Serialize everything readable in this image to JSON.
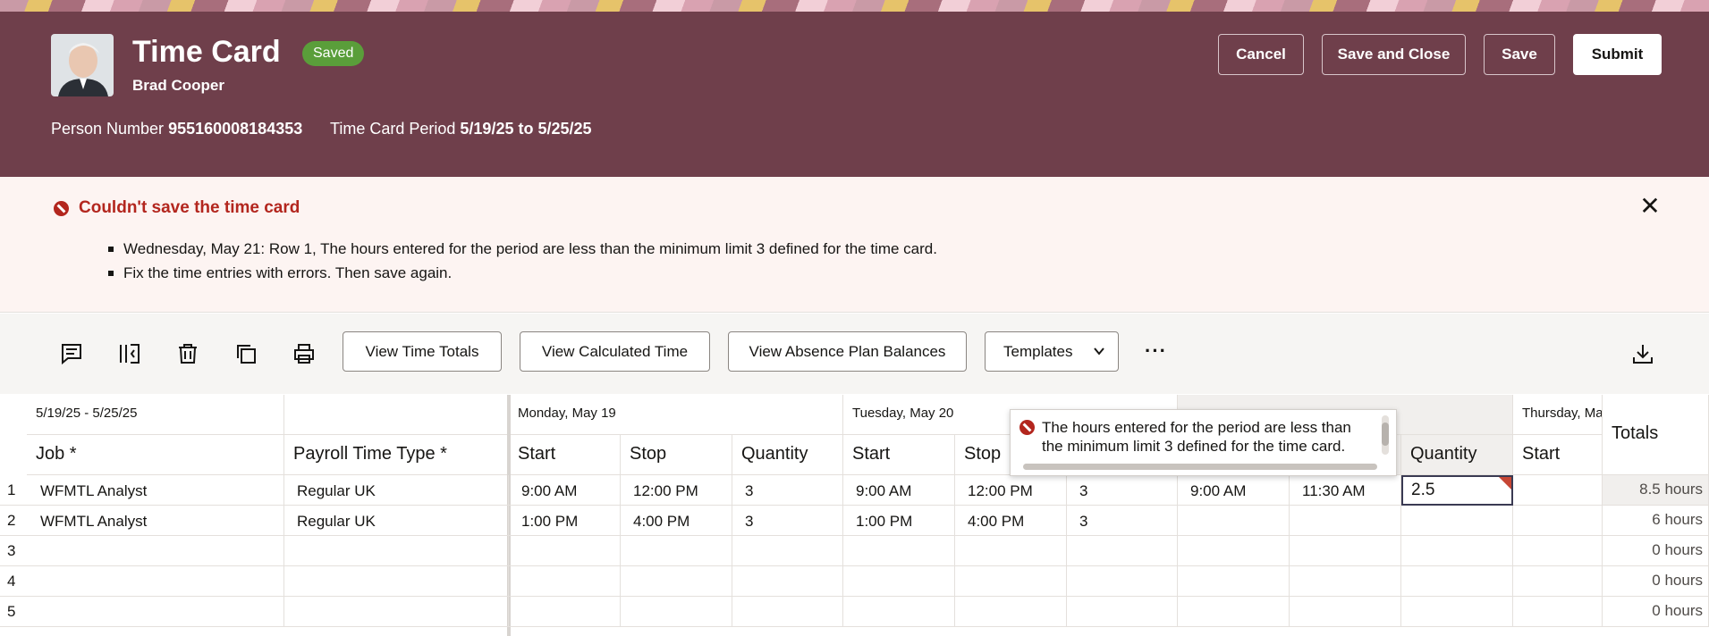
{
  "header": {
    "title": "Time Card",
    "status_badge": "Saved",
    "person_name": "Brad Cooper",
    "person_number_label": "Person Number",
    "person_number": "955160008184353",
    "period_label": "Time Card Period",
    "period": "5/19/25 to 5/25/25",
    "buttons": {
      "cancel": "Cancel",
      "save_close": "Save and Close",
      "save": "Save",
      "submit": "Submit"
    }
  },
  "error": {
    "title": "Couldn't save the time card",
    "messages": [
      "Wednesday, May 21: Row 1, The hours entered for the period are less than the minimum limit 3 defined for the time card.",
      "Fix the time entries with errors. Then save again."
    ]
  },
  "toolbar": {
    "icons": [
      "comment-icon",
      "columns-icon",
      "delete-icon",
      "duplicate-icon",
      "print-icon"
    ],
    "buttons": {
      "view_totals": "View Time Totals",
      "view_calculated": "View Calculated Time",
      "view_absence": "View Absence Plan Balances",
      "templates": "Templates"
    },
    "more": "···"
  },
  "grid": {
    "date_range": "5/19/25 - 5/25/25",
    "days": [
      "Monday, May 19",
      "Tuesday, May 20",
      "Thursday, Ma"
    ],
    "columns": {
      "job": "Job *",
      "payroll": "Payroll Time Type *",
      "start": "Start",
      "stop": "Stop",
      "quantity": "Quantity",
      "totals": "Totals"
    },
    "rows": [
      {
        "num": "1",
        "job": "WFMTL Analyst",
        "payroll": "Regular UK",
        "mon_start": "9:00 AM",
        "mon_stop": "12:00 PM",
        "mon_qty": "3",
        "tue_start": "9:00 AM",
        "tue_stop": "12:00 PM",
        "tue_qty": "3",
        "wed_start": "9:00 AM",
        "wed_stop": "11:30 AM",
        "wed_qty": "2.5",
        "total": "8.5 hours"
      },
      {
        "num": "2",
        "job": "WFMTL Analyst",
        "payroll": "Regular UK",
        "mon_start": "1:00 PM",
        "mon_stop": "4:00 PM",
        "mon_qty": "3",
        "tue_start": "1:00 PM",
        "tue_stop": "4:00 PM",
        "tue_qty": "3",
        "wed_start": "",
        "wed_stop": "",
        "wed_qty": "",
        "total": "6 hours"
      },
      {
        "num": "3",
        "total": "0 hours"
      },
      {
        "num": "4",
        "total": "0 hours"
      },
      {
        "num": "5",
        "total": "0 hours"
      }
    ]
  },
  "tooltip": {
    "message": "The hours entered for the period are less than the minimum limit 3 defined for the time card."
  },
  "colors": {
    "header_bg": "#6f3f4b",
    "badge_green": "#5a9e3a",
    "error_red": "#b3261e",
    "error_bg": "#fdf4f2"
  }
}
